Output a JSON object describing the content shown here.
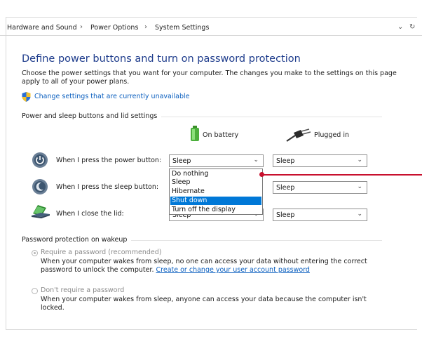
{
  "breadcrumb": {
    "items": [
      "Hardware and Sound",
      "Power Options",
      "System Settings"
    ],
    "separator": "›"
  },
  "address_bar": {
    "dropdown_icon": "chevron-down-icon",
    "refresh_icon": "refresh-icon"
  },
  "page": {
    "title": "Define power buttons and turn on password protection",
    "description": "Choose the power settings that you want for your computer. The changes you make to the settings on this page apply to all of your power plans.",
    "change_link": "Change settings that are currently unavailable"
  },
  "power_section": {
    "title": "Power and sleep buttons and lid settings",
    "columns": {
      "on_battery": "On battery",
      "plugged_in": "Plugged in"
    },
    "rows": [
      {
        "label": "When I press the power button:",
        "battery": "Sleep",
        "plugged": "Sleep"
      },
      {
        "label": "When I press the sleep button:",
        "battery": "Sleep",
        "plugged": "Sleep"
      },
      {
        "label": "When I close the lid:",
        "battery": "Sleep",
        "plugged": "Sleep"
      }
    ]
  },
  "dropdown": {
    "options": [
      "Do nothing",
      "Sleep",
      "Hibernate",
      "Shut down",
      "Turn off the display"
    ],
    "highlighted": "Shut down"
  },
  "password_section": {
    "title": "Password protection on wakeup",
    "require": {
      "label": "Require a password (recommended)",
      "desc": "When your computer wakes from sleep, no one can access your data without entering the correct password to unlock the computer.",
      "link": "Create or change your user account password",
      "selected": true
    },
    "dont_require": {
      "label": "Don't require a password",
      "desc": "When your computer wakes from sleep, anyone can access your data because the computer isn't locked.",
      "selected": false
    }
  },
  "colors": {
    "title": "#1e3c8c",
    "link": "#0b5fbf",
    "highlight": "#0078d7",
    "callout": "#c8102e"
  }
}
